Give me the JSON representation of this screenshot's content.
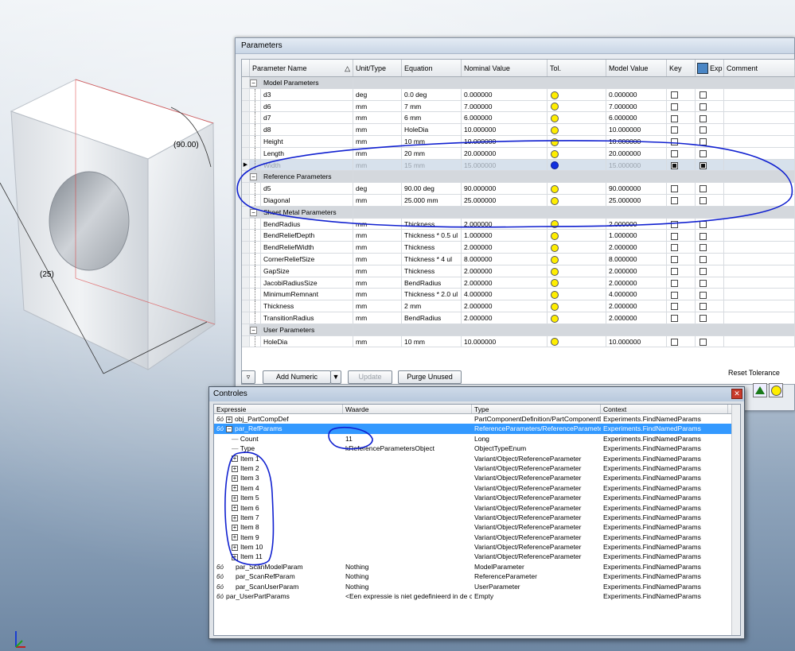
{
  "part_view": {
    "dim_angle": "(90.00)",
    "dim_diag": "(25)"
  },
  "params_dialog": {
    "title": "Parameters",
    "headers": {
      "name": "Parameter Name",
      "sort_icon": "sort-triangle-icon",
      "unit": "Unit/Type",
      "equation": "Equation",
      "nominal": "Nominal Value",
      "tol": "Tol.",
      "model": "Model Value",
      "key": "Key",
      "exp": "Exp",
      "comment": "Comment"
    },
    "groups": [
      {
        "label": "Model Parameters",
        "rows": [
          {
            "name": "d3",
            "unit": "deg",
            "eq": "0.0 deg",
            "nom": "0.000000",
            "model": "0.000000"
          },
          {
            "name": "d6",
            "unit": "mm",
            "eq": "7 mm",
            "nom": "7.000000",
            "model": "7.000000"
          },
          {
            "name": "d7",
            "unit": "mm",
            "eq": "6 mm",
            "nom": "6.000000",
            "model": "6.000000"
          },
          {
            "name": "d8",
            "unit": "mm",
            "eq": "HoleDia",
            "nom": "10.000000",
            "model": "10.000000"
          },
          {
            "name": "Height",
            "unit": "mm",
            "eq": "10 mm",
            "nom": "10.000000",
            "model": "10.000000"
          },
          {
            "name": "Length",
            "unit": "mm",
            "eq": "20 mm",
            "nom": "20.000000",
            "model": "20.000000"
          },
          {
            "name": "Width",
            "unit": "mm",
            "eq": "15 mm",
            "nom": "15.000000",
            "model": "15.000000",
            "selected": true
          }
        ]
      },
      {
        "label": "Reference Parameters",
        "rows": [
          {
            "name": "d5",
            "unit": "deg",
            "eq": "90.00 deg",
            "nom": "90.000000",
            "model": "90.000000"
          },
          {
            "name": "Diagonal",
            "unit": "mm",
            "eq": "25.000 mm",
            "nom": "25.000000",
            "model": "25.000000"
          }
        ]
      },
      {
        "label": "Sheet Metal Parameters",
        "rows": [
          {
            "name": "BendRadius",
            "unit": "mm",
            "eq": "Thickness",
            "nom": "2.000000",
            "model": "2.000000"
          },
          {
            "name": "BendReliefDepth",
            "unit": "mm",
            "eq": "Thickness * 0.5 ul",
            "nom": "1.000000",
            "model": "1.000000"
          },
          {
            "name": "BendReliefWidth",
            "unit": "mm",
            "eq": "Thickness",
            "nom": "2.000000",
            "model": "2.000000"
          },
          {
            "name": "CornerReliefSize",
            "unit": "mm",
            "eq": "Thickness * 4 ul",
            "nom": "8.000000",
            "model": "8.000000"
          },
          {
            "name": "GapSize",
            "unit": "mm",
            "eq": "Thickness",
            "nom": "2.000000",
            "model": "2.000000"
          },
          {
            "name": "JacobiRadiusSize",
            "unit": "mm",
            "eq": "BendRadius",
            "nom": "2.000000",
            "model": "2.000000"
          },
          {
            "name": "MinimumRemnant",
            "unit": "mm",
            "eq": "Thickness * 2.0 ul",
            "nom": "4.000000",
            "model": "4.000000"
          },
          {
            "name": "Thickness",
            "unit": "mm",
            "eq": "2 mm",
            "nom": "2.000000",
            "model": "2.000000"
          },
          {
            "name": "TransitionRadius",
            "unit": "mm",
            "eq": "BendRadius",
            "nom": "2.000000",
            "model": "2.000000"
          }
        ]
      },
      {
        "label": "User Parameters",
        "rows": [
          {
            "name": "HoleDia",
            "unit": "mm",
            "eq": "10 mm",
            "nom": "10.000000",
            "model": "10.000000"
          }
        ]
      }
    ],
    "toolbar": {
      "filter_icon": "filter-icon",
      "add_numeric": "Add Numeric",
      "dropdown_icon": "dropdown-arrow-icon",
      "update": "Update",
      "purge_unused": "Purge Unused",
      "reset_tolerance": "Reset Tolerance"
    }
  },
  "controles": {
    "title": "Controles",
    "close_icon": "close-icon",
    "headers": {
      "expr": "Expressie",
      "val": "Waarde",
      "type": "Type",
      "ctx": "Context"
    },
    "rows": [
      {
        "expr": "obj_PartCompDef",
        "val": "",
        "type": "PartComponentDefinition/PartComponentDe",
        "ctx": "Experiments.FindNamedParams",
        "glasses": true,
        "box": "+",
        "indent": 0
      },
      {
        "expr": "par_RefParams",
        "val": "",
        "type": "ReferenceParameters/ReferenceParamete",
        "ctx": "Experiments.FindNamedParams",
        "glasses": true,
        "box": "−",
        "indent": 0,
        "selected": true
      },
      {
        "expr": "Count",
        "val": "11",
        "type": "Long",
        "ctx": "Experiments.FindNamedParams",
        "indent": 1
      },
      {
        "expr": "Type",
        "val": "kReferenceParametersObject",
        "type": "ObjectTypeEnum",
        "ctx": "Experiments.FindNamedParams",
        "indent": 1
      },
      {
        "expr": "Item 1",
        "val": "",
        "type": "Variant/Object/ReferenceParameter",
        "ctx": "Experiments.FindNamedParams",
        "box": "+",
        "indent": 1
      },
      {
        "expr": "Item 2",
        "val": "",
        "type": "Variant/Object/ReferenceParameter",
        "ctx": "Experiments.FindNamedParams",
        "box": "+",
        "indent": 1
      },
      {
        "expr": "Item 3",
        "val": "",
        "type": "Variant/Object/ReferenceParameter",
        "ctx": "Experiments.FindNamedParams",
        "box": "+",
        "indent": 1
      },
      {
        "expr": "Item 4",
        "val": "",
        "type": "Variant/Object/ReferenceParameter",
        "ctx": "Experiments.FindNamedParams",
        "box": "+",
        "indent": 1
      },
      {
        "expr": "Item 5",
        "val": "",
        "type": "Variant/Object/ReferenceParameter",
        "ctx": "Experiments.FindNamedParams",
        "box": "+",
        "indent": 1
      },
      {
        "expr": "Item 6",
        "val": "",
        "type": "Variant/Object/ReferenceParameter",
        "ctx": "Experiments.FindNamedParams",
        "box": "+",
        "indent": 1
      },
      {
        "expr": "Item 7",
        "val": "",
        "type": "Variant/Object/ReferenceParameter",
        "ctx": "Experiments.FindNamedParams",
        "box": "+",
        "indent": 1
      },
      {
        "expr": "Item 8",
        "val": "",
        "type": "Variant/Object/ReferenceParameter",
        "ctx": "Experiments.FindNamedParams",
        "box": "+",
        "indent": 1
      },
      {
        "expr": "Item 9",
        "val": "",
        "type": "Variant/Object/ReferenceParameter",
        "ctx": "Experiments.FindNamedParams",
        "box": "+",
        "indent": 1
      },
      {
        "expr": "Item 10",
        "val": "",
        "type": "Variant/Object/ReferenceParameter",
        "ctx": "Experiments.FindNamedParams",
        "box": "+",
        "indent": 1
      },
      {
        "expr": "Item 11",
        "val": "",
        "type": "Variant/Object/ReferenceParameter",
        "ctx": "Experiments.FindNamedParams",
        "box": "+",
        "indent": 1
      },
      {
        "expr": "par_ScanModelParam",
        "val": "Nothing",
        "type": "ModelParameter",
        "ctx": "Experiments.FindNamedParams",
        "glasses": true,
        "indent": 0
      },
      {
        "expr": "par_ScanRefParam",
        "val": "Nothing",
        "type": "ReferenceParameter",
        "ctx": "Experiments.FindNamedParams",
        "glasses": true,
        "indent": 0
      },
      {
        "expr": "par_ScanUserParam",
        "val": "Nothing",
        "type": "UserParameter",
        "ctx": "Experiments.FindNamedParams",
        "glasses": true,
        "indent": 0
      },
      {
        "expr": "par_UserPartParams",
        "val": "<Een expressie is niet gedefinieerd in de c",
        "type": "Empty",
        "ctx": "Experiments.FindNamedParams",
        "glasses": true,
        "indent": -1
      }
    ]
  },
  "colors": {
    "selection": "#3399ff",
    "tol_dot": "#ffee00",
    "annotation": "#1020d0"
  }
}
